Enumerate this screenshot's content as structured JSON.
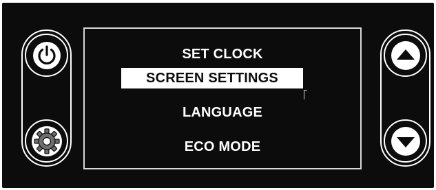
{
  "menu": {
    "items": [
      {
        "label": "SET CLOCK",
        "selected": false
      },
      {
        "label": "SCREEN SETTINGS",
        "selected": true
      },
      {
        "label": "LANGUAGE",
        "selected": false
      },
      {
        "label": "ECO MODE",
        "selected": false
      }
    ]
  },
  "controls": {
    "left": {
      "top_icon": "power-icon",
      "bottom_icon": "gear-icon"
    },
    "right": {
      "top_icon": "arrow-up-icon",
      "bottom_icon": "arrow-down-icon"
    }
  },
  "colors": {
    "panel": "#0c0c0c",
    "foreground": "#ffffff",
    "screen_border": "#d9d9d9"
  }
}
